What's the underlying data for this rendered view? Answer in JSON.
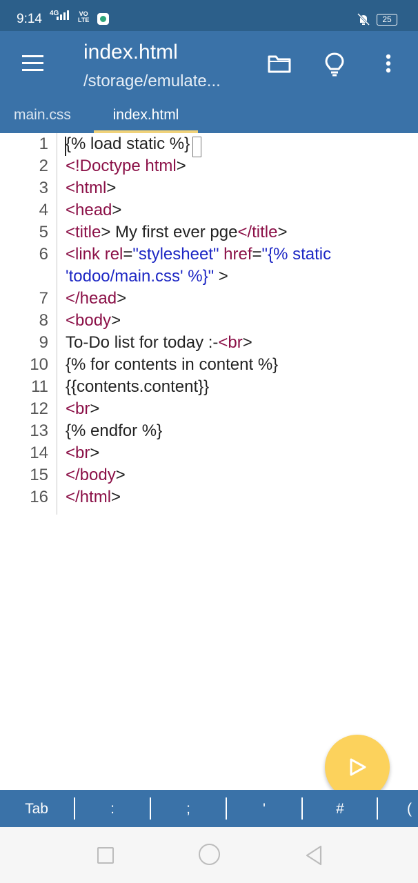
{
  "status_bar": {
    "time": "9:14",
    "network_type": "4G",
    "volte_top": "VO",
    "volte_bottom": "LTE",
    "battery": "25"
  },
  "toolbar": {
    "title": "index.html",
    "subtitle": "/storage/emulate...",
    "icons": [
      "menu-icon",
      "folder-icon",
      "lightbulb-icon",
      "more-vertical-icon"
    ]
  },
  "tabs": [
    {
      "label": "main.css",
      "active": false
    },
    {
      "label": "index.html",
      "active": true
    }
  ],
  "editor": {
    "lines": [
      {
        "num": "1",
        "parts": [
          {
            "t": "{% load static %}",
            "c": "plain"
          }
        ]
      },
      {
        "num": "2",
        "parts": [
          {
            "t": "<!Doctype html",
            "c": "tag"
          },
          {
            "t": ">",
            "c": "plain"
          }
        ]
      },
      {
        "num": "3",
        "parts": [
          {
            "t": "<html",
            "c": "tag"
          },
          {
            "t": ">",
            "c": "plain"
          }
        ]
      },
      {
        "num": "4",
        "parts": [
          {
            "t": "<head",
            "c": "tag"
          },
          {
            "t": ">",
            "c": "plain"
          }
        ]
      },
      {
        "num": "5",
        "parts": [
          {
            "t": "<title",
            "c": "tag"
          },
          {
            "t": "> My first ever pge",
            "c": "plain"
          },
          {
            "t": "</title",
            "c": "tag"
          },
          {
            "t": ">",
            "c": "plain"
          }
        ]
      },
      {
        "num": "6",
        "parts": [
          {
            "t": "<link ",
            "c": "tag"
          },
          {
            "t": "rel",
            "c": "attr"
          },
          {
            "t": "=",
            "c": "plain"
          },
          {
            "t": "\"stylesheet\"",
            "c": "str"
          },
          {
            "t": " ",
            "c": "plain"
          },
          {
            "t": "href",
            "c": "attr"
          },
          {
            "t": "=",
            "c": "plain"
          },
          {
            "t": "\"{% static",
            "c": "str"
          }
        ]
      },
      {
        "num": "",
        "parts": [
          {
            "t": "'todoo/main.css' %}\"",
            "c": "str"
          },
          {
            "t": " >",
            "c": "plain"
          }
        ]
      },
      {
        "num": "7",
        "parts": [
          {
            "t": "</head",
            "c": "tag"
          },
          {
            "t": ">",
            "c": "plain"
          }
        ]
      },
      {
        "num": "8",
        "parts": [
          {
            "t": "<body",
            "c": "tag"
          },
          {
            "t": ">",
            "c": "plain"
          }
        ]
      },
      {
        "num": "9",
        "parts": [
          {
            "t": "To-Do list for today :-",
            "c": "plain"
          },
          {
            "t": "<br",
            "c": "tag"
          },
          {
            "t": ">",
            "c": "plain"
          }
        ]
      },
      {
        "num": "10",
        "parts": [
          {
            "t": "{% for contents in content %}",
            "c": "plain"
          }
        ]
      },
      {
        "num": "11",
        "parts": [
          {
            "t": "{{contents.content}}",
            "c": "plain"
          }
        ]
      },
      {
        "num": "12",
        "parts": [
          {
            "t": "<br",
            "c": "tag"
          },
          {
            "t": ">",
            "c": "plain"
          }
        ]
      },
      {
        "num": "13",
        "parts": [
          {
            "t": "{% endfor %}",
            "c": "plain"
          }
        ]
      },
      {
        "num": "14",
        "parts": [
          {
            "t": "<br",
            "c": "tag"
          },
          {
            "t": ">",
            "c": "plain"
          }
        ]
      },
      {
        "num": "15",
        "parts": [
          {
            "t": "</body",
            "c": "tag"
          },
          {
            "t": ">",
            "c": "plain"
          }
        ]
      },
      {
        "num": "16",
        "parts": [
          {
            "t": "</html",
            "c": "tag"
          },
          {
            "t": ">",
            "c": "plain"
          }
        ]
      }
    ]
  },
  "fab": {
    "icon": "play-icon",
    "color": "#fcd25c"
  },
  "keybar": {
    "keys": [
      "Tab",
      ":",
      ";",
      "'",
      "#",
      "("
    ]
  },
  "colors": {
    "toolbar": "#3a72a8",
    "status_bar": "#2c5f8a",
    "tab_indicator": "#f0d27a",
    "tag": "#8b1047",
    "string": "#1d27c4"
  }
}
